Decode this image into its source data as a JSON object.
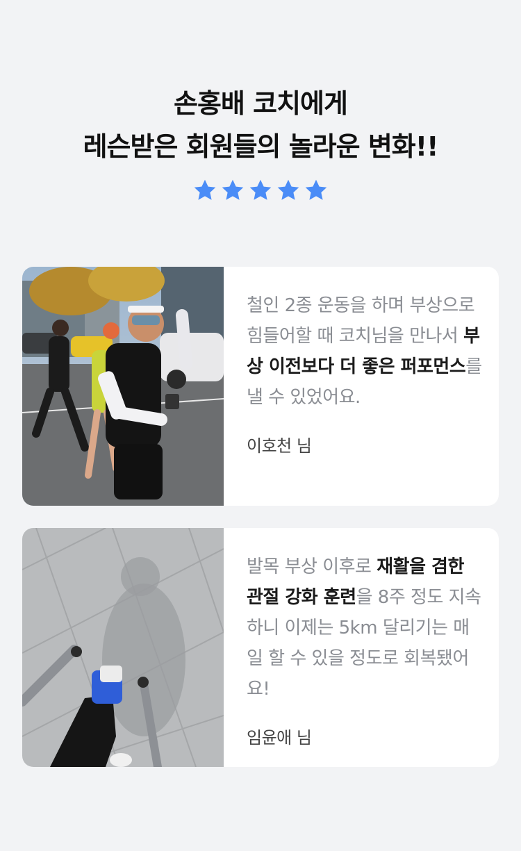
{
  "header": {
    "title_line1": "손홍배 코치에게",
    "title_line2": "레슨받은 회원들의 놀라운 변화!!",
    "rating": 5,
    "star_color": "#4a8cf7"
  },
  "reviews": [
    {
      "photo_icon": "runner-photo",
      "quote_pre": "철인 2종 운동을 하며 부상으로 힘들어할 때 코치님을 만나서 ",
      "quote_bold": "부상 이전보다 더 좋은 퍼포먼스",
      "quote_post": "를 낼 수 있었어요.",
      "author": "이호천 님"
    },
    {
      "photo_icon": "crutches-photo",
      "quote_pre": "발목 부상 이후로 ",
      "quote_bold": "재활을 겸한 관절 강화 훈련",
      "quote_post": "을 8주 정도 지속하니 이제는 5km 달리기는 매일 할 수 있을 정도로 회복됐어요!",
      "author": "임윤애 님"
    }
  ]
}
